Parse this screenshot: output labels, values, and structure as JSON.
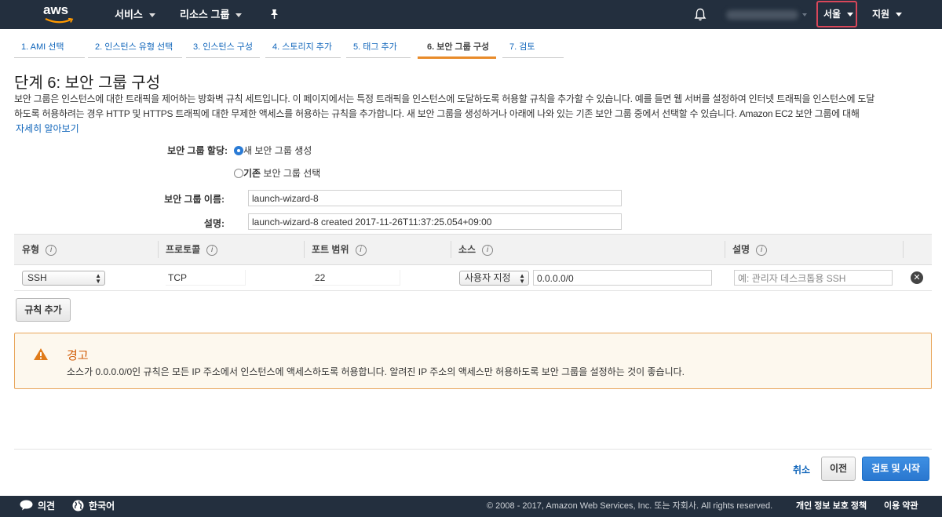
{
  "topnav": {
    "logo": "aws",
    "services": "서비스",
    "resource_groups": "리소스 그룹",
    "region": "서울",
    "support": "지원"
  },
  "tabs": [
    {
      "label": "1. AMI 선택",
      "active": false
    },
    {
      "label": "2. 인스턴스 유형 선택",
      "active": false
    },
    {
      "label": "3. 인스턴스 구성",
      "active": false
    },
    {
      "label": "4. 스토리지 추가",
      "active": false
    },
    {
      "label": "5. 태그 추가",
      "active": false
    },
    {
      "label": "6. 보안 그룹 구성",
      "active": true
    },
    {
      "label": "7. 검토",
      "active": false
    }
  ],
  "page": {
    "title": "단계 6: 보안 그룹 구성",
    "intro_line1": "보안 그룹은 인스턴스에 대한 트래픽을 제어하는 방화벽 규칙 세트입니다. 이 페이지에서는 특정 트래픽을 인스턴스에 도달하도록 허용할 규칙을 추가할 수 있습니다. 예를 들면 웹 서버를 설정하여 인터넷 트래픽을 인스턴스에 도달",
    "intro_line2": "하도록 허용하려는 경우 HTTP 및 HTTPS 트래픽에 대한 무제한 액세스를 허용하는 규칙을 추가합니다. 새 보안 그룹을 생성하거나 아래에 나와 있는 기존 보안 그룹 중에서 선택할 수 있습니다. Amazon EC2 보안 그룹에 대해",
    "learn_more": "자세히 알아보기"
  },
  "form": {
    "assign_label": "보안 그룹 할당:",
    "option_new": "새 보안 그룹 생성",
    "option_existing_bold": "기존",
    "option_existing_rest": " 보안 그룹 선택",
    "name_label": "보안 그룹 이름:",
    "name_value": "launch-wizard-8",
    "desc_label": "설명:",
    "desc_value": "launch-wizard-8 created 2017-11-26T11:37:25.054+09:00"
  },
  "table": {
    "headers": [
      "유형",
      "프로토콜",
      "포트 범위",
      "소스",
      "설명"
    ],
    "info_glyph": "i",
    "rows": [
      {
        "type": "SSH",
        "protocol": "TCP",
        "port_range": "22",
        "source_mode": "사용자 지정",
        "source_value": "0.0.0.0/0",
        "description_placeholder": "예: 관리자 데스크톱용 SSH"
      }
    ],
    "add_rule": "규칙 추가"
  },
  "warning": {
    "title": "경고",
    "text": "소스가 0.0.0.0/0인 규칙은 모든 IP 주소에서 인스턴스에 액세스하도록 허용합니다. 알려진 IP 주소의 액세스만 허용하도록 보안 그룹을 설정하는 것이 좋습니다."
  },
  "actions": {
    "cancel": "취소",
    "previous": "이전",
    "review_launch": "검토 및 시작"
  },
  "footer": {
    "feedback": "의견",
    "language": "한국어",
    "copyright": "© 2008 - 2017, Amazon Web Services, Inc. 또는 자회사. All rights reserved.",
    "privacy": "개인 정보 보호 정책",
    "terms": "이용 약관"
  },
  "colors": {
    "nav_bg": "#232f3e",
    "link": "#1166bb",
    "active_tab": "#e88b2a",
    "primary": "#2a77cf",
    "warning": "#d15d08"
  }
}
